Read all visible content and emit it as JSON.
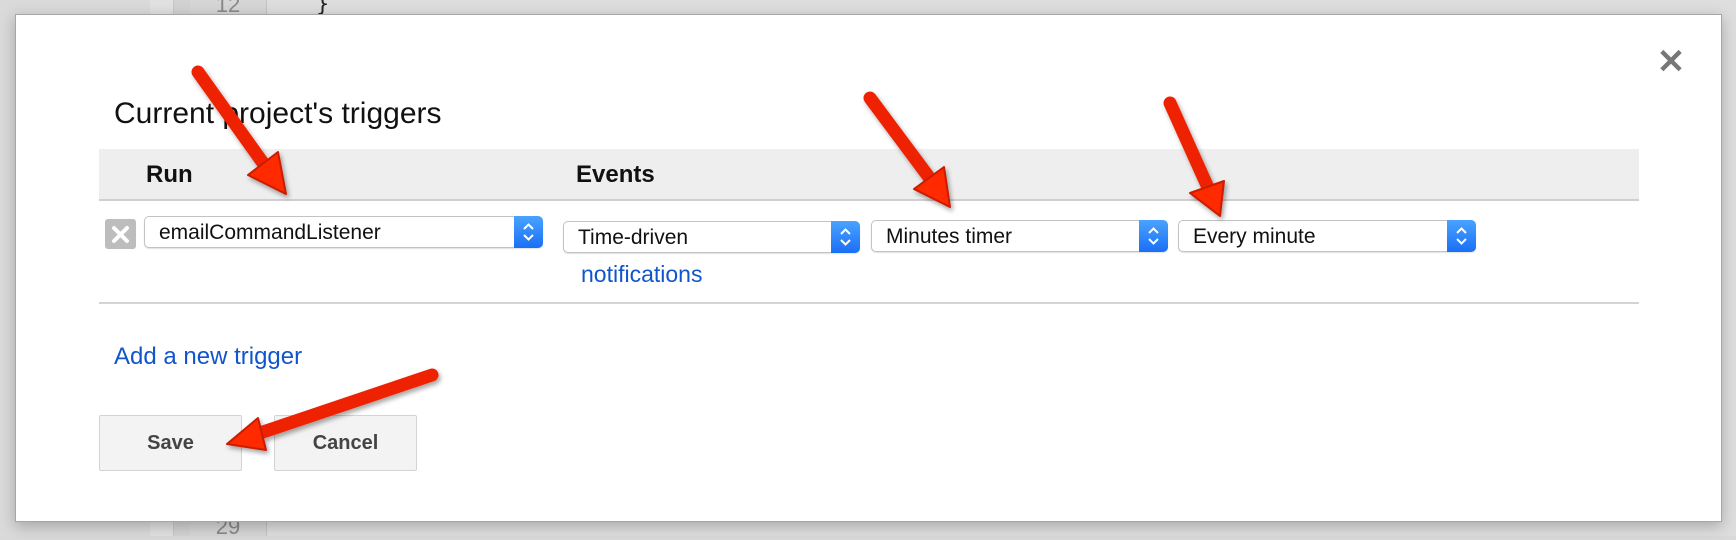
{
  "background_editor": {
    "line_number_top": "12",
    "line_number_bottom": "29",
    "code_fragment_top": "}"
  },
  "dialog": {
    "title": "Current project's triggers",
    "close_icon": "close-icon",
    "table": {
      "columns": [
        "Run",
        "Events"
      ],
      "rows": [
        {
          "delete_icon": "delete-x-icon",
          "run_function": "emailCommandListener",
          "event_source": "Time-driven",
          "timer_type": "Minutes timer",
          "interval": "Every minute",
          "notifications_link": "notifications"
        }
      ]
    },
    "add_trigger_link": "Add a new trigger",
    "buttons": {
      "save": "Save",
      "cancel": "Cancel"
    }
  },
  "annotations": {
    "arrow_color": "#ff2200",
    "arrows": [
      {
        "points_to": "run-function-select"
      },
      {
        "points_to": "timer-type-select"
      },
      {
        "points_to": "interval-select"
      },
      {
        "points_to": "save-button"
      }
    ]
  },
  "colors": {
    "link": "#1155cc",
    "stepper": "#1a6ff5",
    "header_band": "#eeeeee"
  }
}
